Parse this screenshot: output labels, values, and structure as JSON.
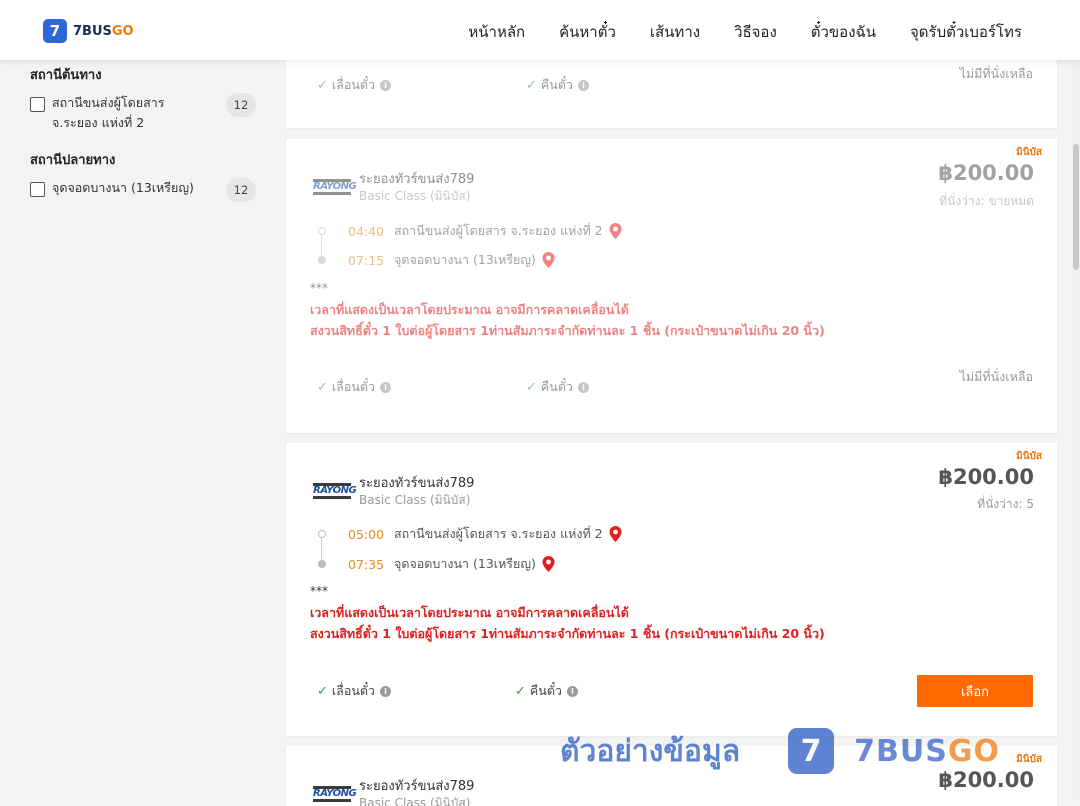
{
  "header": {
    "logo_badge": "7",
    "logo_text_part1": "7BUS",
    "logo_text_part2": "GO",
    "nav": [
      "หน้าหลัก",
      "ค้นหาตั๋ว",
      "เส้นทาง",
      "วิธีจอง",
      "ตั๋วของฉัน",
      "จุดรับตั๋วเบอร์โทร"
    ]
  },
  "sidebar": {
    "origin_title": "สถานีต้นทาง",
    "origin_items": [
      {
        "label": "สถานีขนส่งผู้โดยสาร จ.ระยอง แห่งที่ 2",
        "count": "12"
      }
    ],
    "destination_title": "สถานีปลายทาง",
    "destination_items": [
      {
        "label": "จุดจอดบางนา (13เหรียญ)",
        "count": "12"
      }
    ]
  },
  "card0": {
    "reschedule": "เลื่อนตั๋ว",
    "refund": "คืนตั๋ว",
    "status": "ไม่มีที่นั่งเหลือ"
  },
  "card1": {
    "type": "มินิบัส",
    "operator_logo": "RAYONG",
    "operator": "ระยองทัวร์ขนส่ง789",
    "bus_class": "Basic Class (มินิบัส)",
    "price": "฿200.00",
    "seats": "ที่นั่งว่าง: ขายหมด",
    "depart_time": "04:40",
    "depart_station": "สถานีขนส่งผู้โดยสาร จ.ระยอง แห่งที่ 2",
    "arrive_time": "07:15",
    "arrive_station": "จุดจอดบางนา (13เหรียญ)",
    "stars": "***",
    "note1": "เวลาที่แสดงเป็นเวลาโดยประมาณ อาจมีการคลาดเคลื่อนได้",
    "note2": "สงวนสิทธิ์ตั๋ว 1 ใบต่อผู้โดยสาร 1ท่านสัมภาระจำกัดท่านละ 1 ชิ้น (กระเป๋าขนาดไม่เกิน 20 นิ้ว)",
    "reschedule": "เลื่อนตั๋ว",
    "refund": "คืนตั๋ว",
    "status": "ไม่มีที่นั่งเหลือ"
  },
  "card2": {
    "type": "มินิบัส",
    "operator_logo": "RAYONG",
    "operator": "ระยองทัวร์ขนส่ง789",
    "bus_class": "Basic Class (มินิบัส)",
    "price": "฿200.00",
    "seats": "ที่นั่งว่าง: 5",
    "depart_time": "05:00",
    "depart_station": "สถานีขนส่งผู้โดยสาร จ.ระยอง แห่งที่ 2",
    "arrive_time": "07:35",
    "arrive_station": "จุดจอดบางนา (13เหรียญ)",
    "stars": "***",
    "note1": "เวลาที่แสดงเป็นเวลาโดยประมาณ อาจมีการคลาดเคลื่อนได้",
    "note2": "สงวนสิทธิ์ตั๋ว 1 ใบต่อผู้โดยสาร 1ท่านสัมภาระจำกัดท่านละ 1 ชิ้น (กระเป๋าขนาดไม่เกิน 20 นิ้ว)",
    "reschedule": "เลื่อนตั๋ว",
    "refund": "คืนตั๋ว",
    "select": "เลือก"
  },
  "card3": {
    "type": "มินิบัส",
    "operator_logo": "RAYONG",
    "operator": "ระยองทัวร์ขนส่ง789",
    "bus_class": "Basic Class (มินิบัส)",
    "price": "฿200.00"
  },
  "watermark": {
    "text": "ตัวอย่างข้อมูล",
    "badge": "7",
    "brand_part1": "7BUS",
    "brand_part2": "GO"
  },
  "colors": {
    "accent": "#ff6a00",
    "time": "#e58a1f",
    "note": "#e0201f",
    "check": "#2ea048",
    "brand_blue": "#2f66d7"
  }
}
